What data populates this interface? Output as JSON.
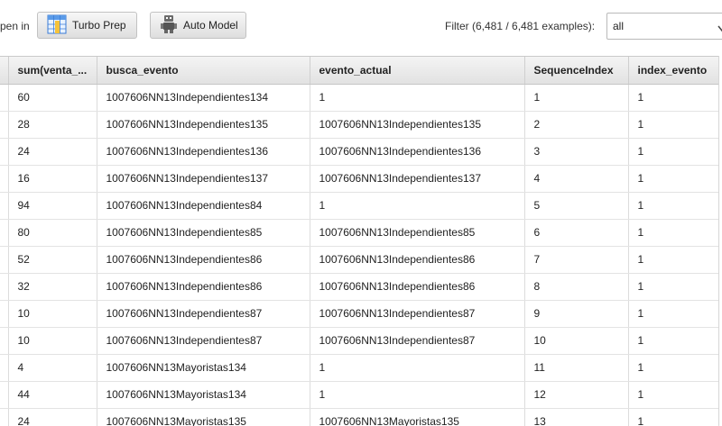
{
  "toolbar": {
    "open_in_label": "pen in",
    "turbo_prep_label": "Turbo Prep",
    "auto_model_label": "Auto Model",
    "filter_label": "Filter (6,481 / 6,481 examples):",
    "filter_value": "all"
  },
  "table": {
    "headers": [
      "sum(venta_...",
      "busca_evento",
      "evento_actual",
      "SequenceIndex",
      "index_evento"
    ],
    "rows": [
      [
        "60",
        "1007606NN13Independientes134",
        "1",
        "1",
        "1"
      ],
      [
        "28",
        "1007606NN13Independientes135",
        "1007606NN13Independientes135",
        "2",
        "1"
      ],
      [
        "24",
        "1007606NN13Independientes136",
        "1007606NN13Independientes136",
        "3",
        "1"
      ],
      [
        "16",
        "1007606NN13Independientes137",
        "1007606NN13Independientes137",
        "4",
        "1"
      ],
      [
        "94",
        "1007606NN13Independientes84",
        "1",
        "5",
        "1"
      ],
      [
        "80",
        "1007606NN13Independientes85",
        "1007606NN13Independientes85",
        "6",
        "1"
      ],
      [
        "52",
        "1007606NN13Independientes86",
        "1007606NN13Independientes86",
        "7",
        "1"
      ],
      [
        "32",
        "1007606NN13Independientes86",
        "1007606NN13Independientes86",
        "8",
        "1"
      ],
      [
        "10",
        "1007606NN13Independientes87",
        "1007606NN13Independientes87",
        "9",
        "1"
      ],
      [
        "10",
        "1007606NN13Independientes87",
        "1007606NN13Independientes87",
        "10",
        "1"
      ],
      [
        "4",
        "1007606NN13Mayoristas134",
        "1",
        "11",
        "1"
      ],
      [
        "44",
        "1007606NN13Mayoristas134",
        "1",
        "12",
        "1"
      ],
      [
        "24",
        "1007606NN13Mayoristas135",
        "1007606NN13Mayoristas135",
        "13",
        "1"
      ]
    ]
  }
}
